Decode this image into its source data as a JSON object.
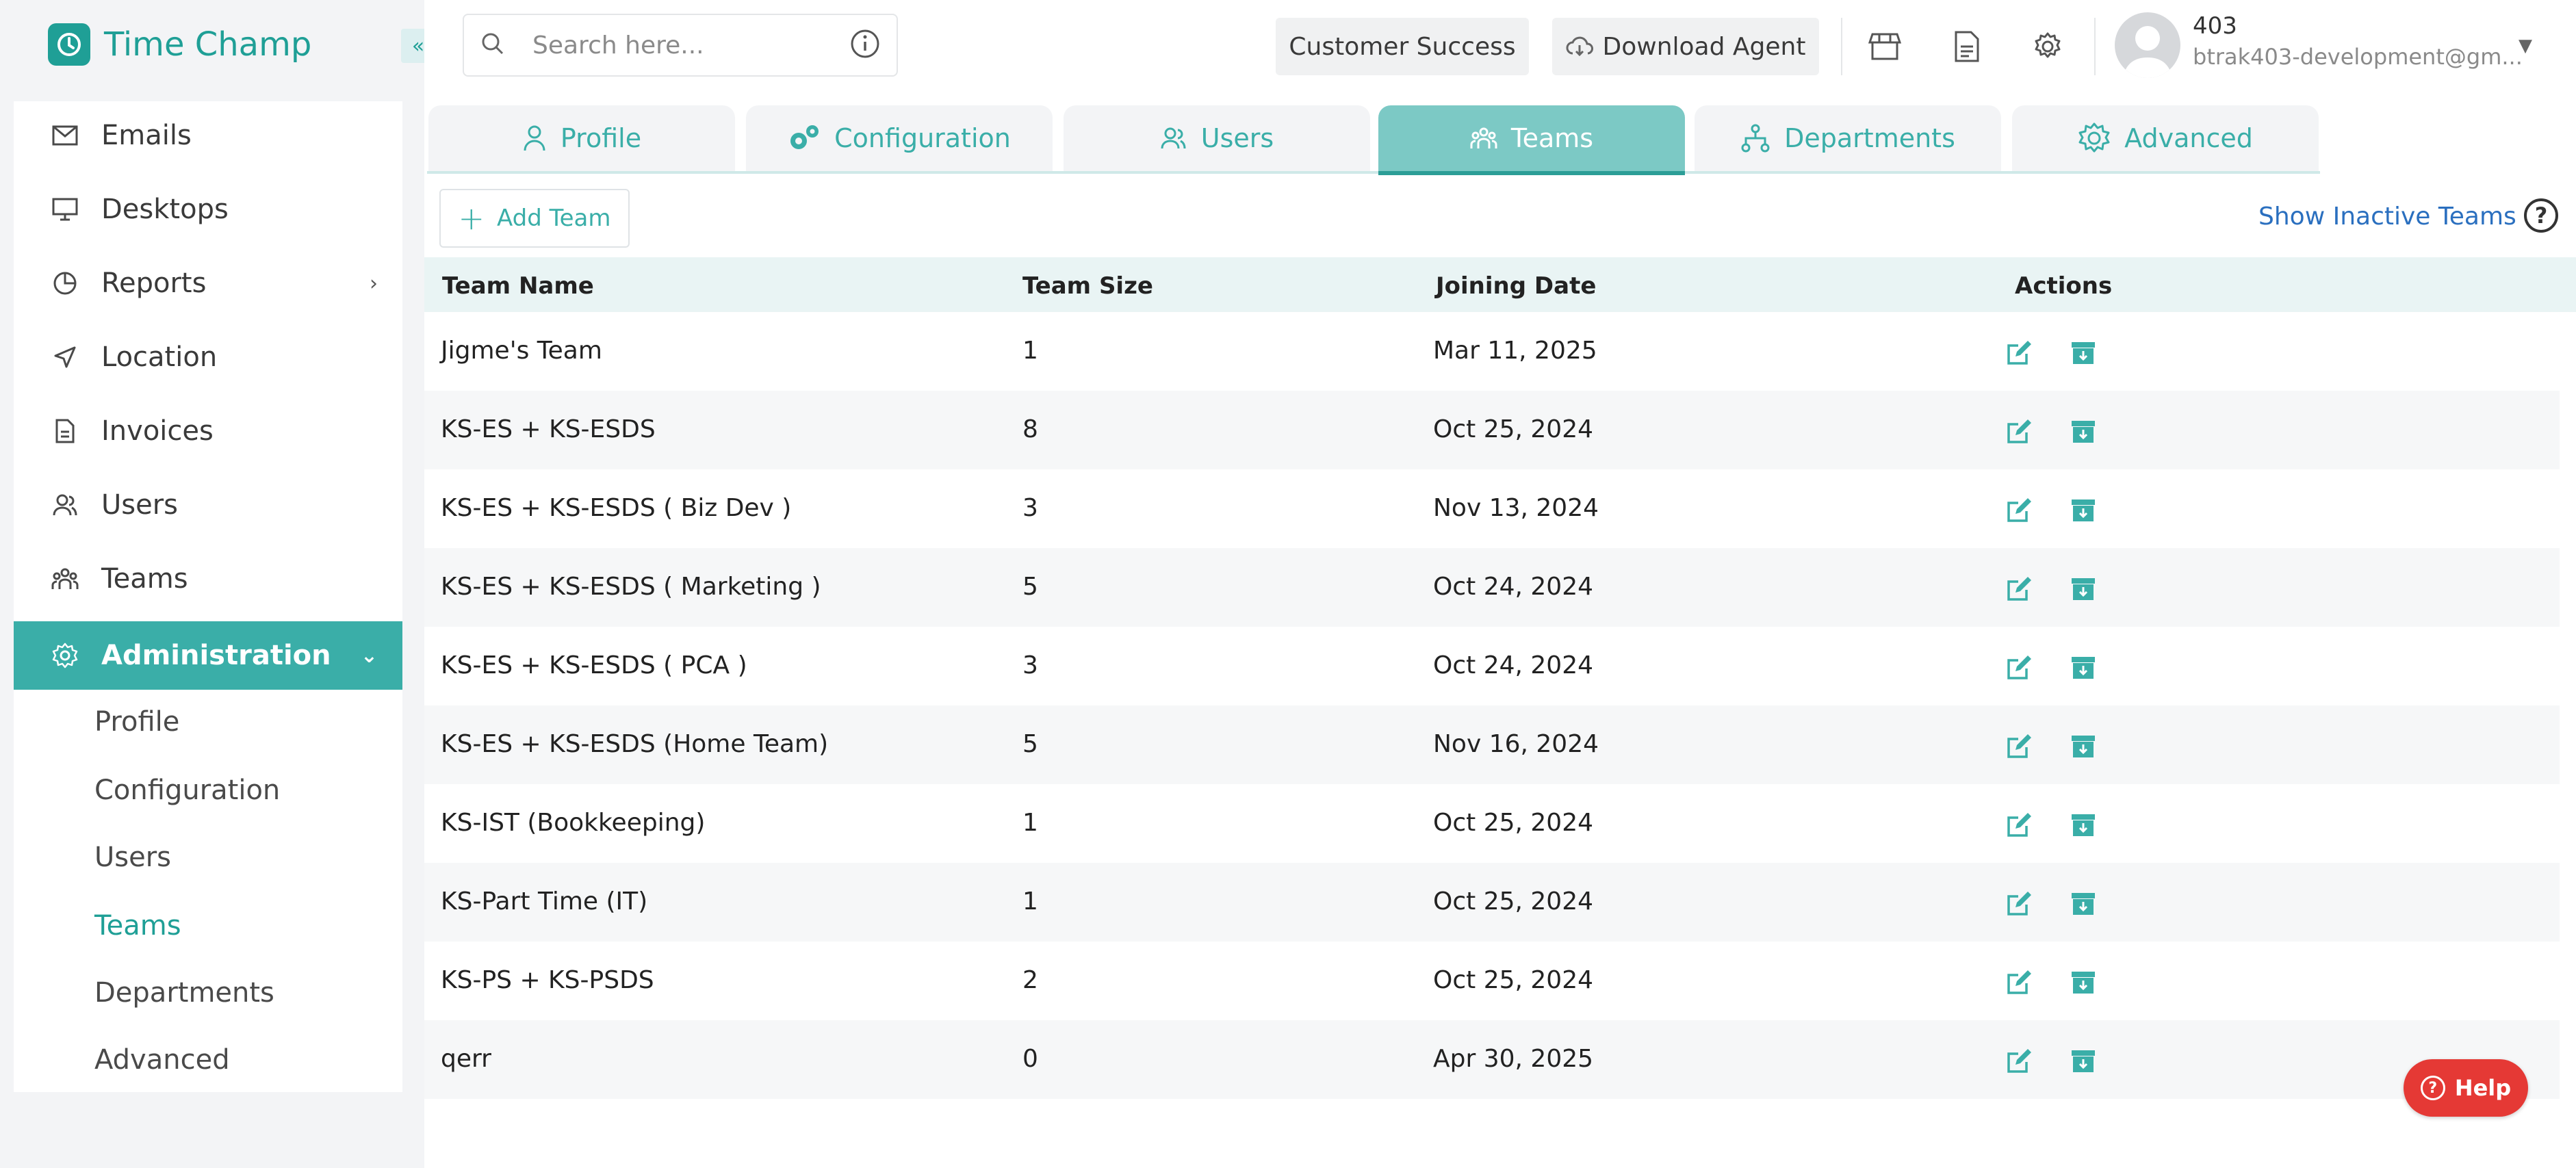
{
  "app": {
    "name": "Time Champ",
    "brand_color": "#1f9f96",
    "collapse_glyph": "«"
  },
  "sidebar": {
    "items": [
      {
        "label": "Emails",
        "icon": "mail-icon"
      },
      {
        "label": "Desktops",
        "icon": "monitor-icon"
      },
      {
        "label": "Reports",
        "icon": "pie-chart-icon",
        "has_arrow": true
      },
      {
        "label": "Location",
        "icon": "location-arrow-icon"
      },
      {
        "label": "Invoices",
        "icon": "invoice-icon"
      },
      {
        "label": "Users",
        "icon": "users-icon"
      },
      {
        "label": "Teams",
        "icon": "teams-icon"
      },
      {
        "label": "Administration",
        "icon": "gear-icon",
        "active": true,
        "expanded": true
      }
    ],
    "submenu": [
      {
        "label": "Profile"
      },
      {
        "label": "Configuration"
      },
      {
        "label": "Users"
      },
      {
        "label": "Teams",
        "active": true
      },
      {
        "label": "Departments"
      },
      {
        "label": "Advanced"
      }
    ]
  },
  "topbar": {
    "search_placeholder": "Search here...",
    "customer_success": "Customer Success",
    "download_agent": "Download Agent",
    "user_name": "403",
    "user_email": "btrak403-development@gm..."
  },
  "tabs": [
    {
      "label": "Profile",
      "icon": "user-icon"
    },
    {
      "label": "Configuration",
      "icon": "gears-icon"
    },
    {
      "label": "Users",
      "icon": "users-icon"
    },
    {
      "label": "Teams",
      "icon": "teams-icon",
      "active": true
    },
    {
      "label": "Departments",
      "icon": "hierarchy-icon"
    },
    {
      "label": "Advanced",
      "icon": "advanced-gear-icon"
    }
  ],
  "toolbar": {
    "add_team": "Add Team",
    "show_inactive": "Show Inactive Teams"
  },
  "table": {
    "headers": [
      "Team Name",
      "Team Size",
      "Joining Date",
      "Actions"
    ],
    "rows": [
      {
        "name": "Jigme's Team",
        "size": "1",
        "date": "Mar 11, 2025"
      },
      {
        "name": "KS-ES + KS-ESDS",
        "size": "8",
        "date": "Oct 25, 2024"
      },
      {
        "name": "KS-ES + KS-ESDS ( Biz Dev )",
        "size": "3",
        "date": "Nov 13, 2024"
      },
      {
        "name": "KS-ES + KS-ESDS ( Marketing )",
        "size": "5",
        "date": "Oct 24, 2024"
      },
      {
        "name": "KS-ES + KS-ESDS ( PCA )",
        "size": "3",
        "date": "Oct 24, 2024"
      },
      {
        "name": "KS-ES + KS-ESDS (Home Team)",
        "size": "5",
        "date": "Nov 16, 2024"
      },
      {
        "name": "KS-IST (Bookkeeping)",
        "size": "1",
        "date": "Oct 25, 2024"
      },
      {
        "name": "KS-Part Time (IT)",
        "size": "1",
        "date": "Oct 25, 2024"
      },
      {
        "name": "KS-PS + KS-PSDS",
        "size": "2",
        "date": "Oct 25, 2024"
      },
      {
        "name": "qerr",
        "size": "0",
        "date": "Apr 30, 2025"
      }
    ]
  },
  "help_button": "Help"
}
